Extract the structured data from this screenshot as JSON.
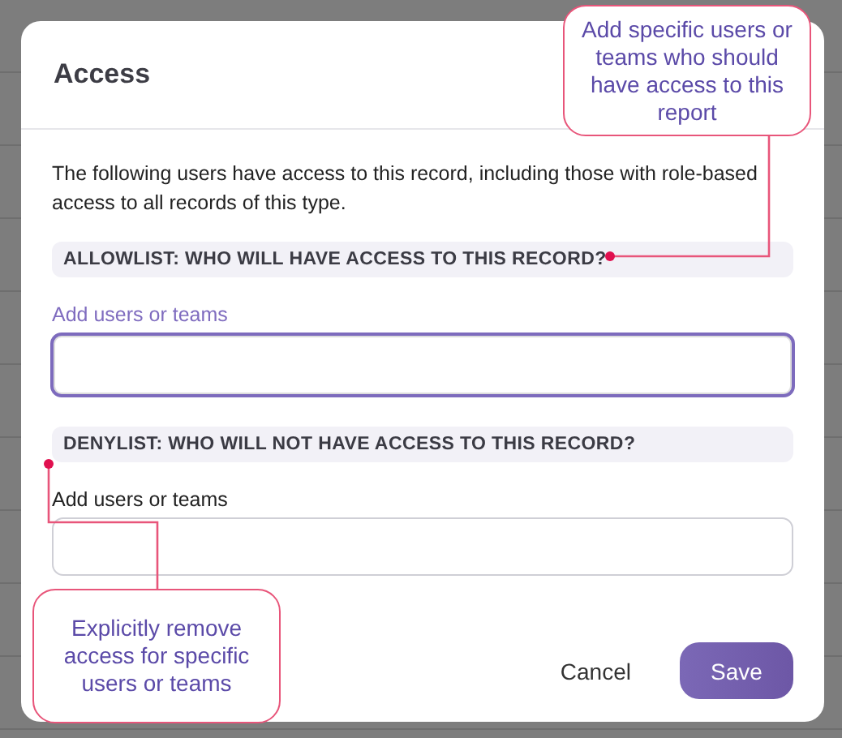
{
  "dialog": {
    "title": "Access",
    "description": "The following users have access to this record, including those with role-based access to all records of this type.",
    "sections": [
      {
        "heading": "ALLOWLIST: WHO WILL HAVE ACCESS TO THIS RECORD?",
        "field_label": "Add users or teams",
        "focused": true
      },
      {
        "heading": "DENYLIST: WHO WILL NOT HAVE ACCESS TO THIS RECORD?",
        "field_label": "Add users or teams",
        "focused": false
      }
    ],
    "buttons": [
      {
        "label": "Cancel",
        "kind": "secondary"
      },
      {
        "label": "Save",
        "kind": "primary"
      }
    ]
  },
  "callouts": [
    {
      "text": "Add specific users or teams who should have access to this report"
    },
    {
      "text": "Explicitly remove access for specific users or teams"
    }
  ]
}
